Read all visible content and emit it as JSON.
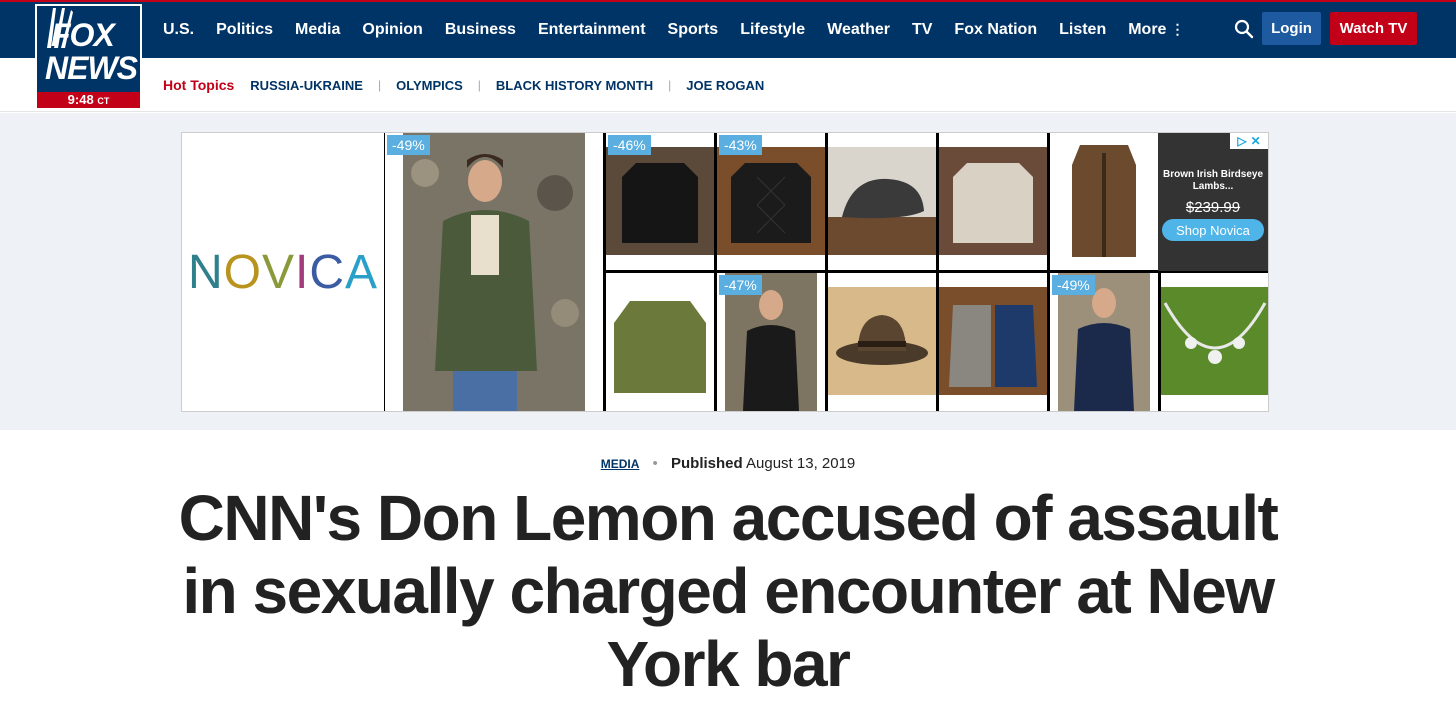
{
  "header": {
    "logo_top": "FOX",
    "logo_bottom": "NEWS",
    "time": "9:48",
    "time_zone": "CT",
    "nav": [
      "U.S.",
      "Politics",
      "Media",
      "Opinion",
      "Business",
      "Entertainment",
      "Sports",
      "Lifestyle",
      "Weather",
      "TV",
      "Fox Nation",
      "Listen",
      "More"
    ],
    "login_label": "Login",
    "watch_label": "Watch TV"
  },
  "subnav": {
    "label": "Hot Topics",
    "topics": [
      "RUSSIA-UKRAINE",
      "OLYMPICS",
      "BLACK HISTORY MONTH",
      "JOE ROGAN"
    ]
  },
  "ad": {
    "brand": "NOVICA",
    "discounts": [
      "-49%",
      "-46%",
      "-43%",
      "-47%",
      "-49%"
    ],
    "product_title": "Brown Irish Birdseye Lambs...",
    "product_price": "$239.99",
    "shop_label": "Shop Novica"
  },
  "article": {
    "category": "MEDIA",
    "published_label": "Published",
    "published_date": "August 13, 2019",
    "headline": "CNN's Don Lemon accused of assault in sexually charged encounter at New York bar"
  },
  "colors": {
    "navy": "#003366",
    "red": "#c20017",
    "ad_badge": "#5aaee0"
  }
}
